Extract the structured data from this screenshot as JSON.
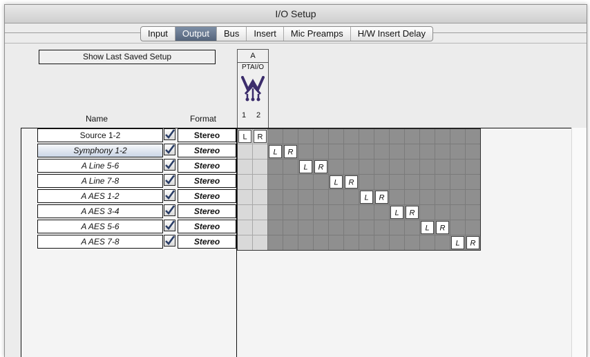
{
  "window": {
    "title": "I/O Setup"
  },
  "tabs": [
    {
      "label": "Input",
      "active": false
    },
    {
      "label": "Output",
      "active": true
    },
    {
      "label": "Bus",
      "active": false
    },
    {
      "label": "Insert",
      "active": false
    },
    {
      "label": "Mic Preamps",
      "active": false
    },
    {
      "label": "H/W Insert Delay",
      "active": false
    }
  ],
  "show_last_saved": "Show Last Saved Setup",
  "columns": {
    "name": "Name",
    "format": "Format"
  },
  "device": {
    "letter": "A",
    "name": "PTAI/O",
    "channels": [
      "1",
      "2"
    ]
  },
  "rows": [
    {
      "name": "Source 1-2",
      "checked": true,
      "format": "Stereo",
      "italic": false,
      "selected": false,
      "assign": [
        "L",
        "R"
      ]
    },
    {
      "name": "Symphony 1-2",
      "checked": true,
      "format": "Stereo",
      "italic": true,
      "selected": true,
      "assign": [
        "L",
        "R"
      ]
    },
    {
      "name": "A Line 5-6",
      "checked": true,
      "format": "Stereo",
      "italic": true,
      "selected": false,
      "assign": [
        "L",
        "R"
      ]
    },
    {
      "name": "A Line 7-8",
      "checked": true,
      "format": "Stereo",
      "italic": true,
      "selected": false,
      "assign": [
        "L",
        "R"
      ]
    },
    {
      "name": "A AES 1-2",
      "checked": true,
      "format": "Stereo",
      "italic": true,
      "selected": false,
      "assign": [
        "L",
        "R"
      ]
    },
    {
      "name": "A AES 3-4",
      "checked": true,
      "format": "Stereo",
      "italic": true,
      "selected": false,
      "assign": [
        "L",
        "R"
      ]
    },
    {
      "name": "A AES 5-6",
      "checked": true,
      "format": "Stereo",
      "italic": true,
      "selected": false,
      "assign": [
        "L",
        "R"
      ]
    },
    {
      "name": "A AES 7-8",
      "checked": true,
      "format": "Stereo",
      "italic": true,
      "selected": false,
      "assign": [
        "L",
        "R"
      ]
    }
  ],
  "icons": {
    "checkbox": "checkmark-icon",
    "device_logo": "ptaio-device-icon"
  },
  "colors": {
    "selected_tab": "#5d6d84",
    "grid_dark": "#8f8f8f",
    "grid_light": "#d9d9d9"
  }
}
